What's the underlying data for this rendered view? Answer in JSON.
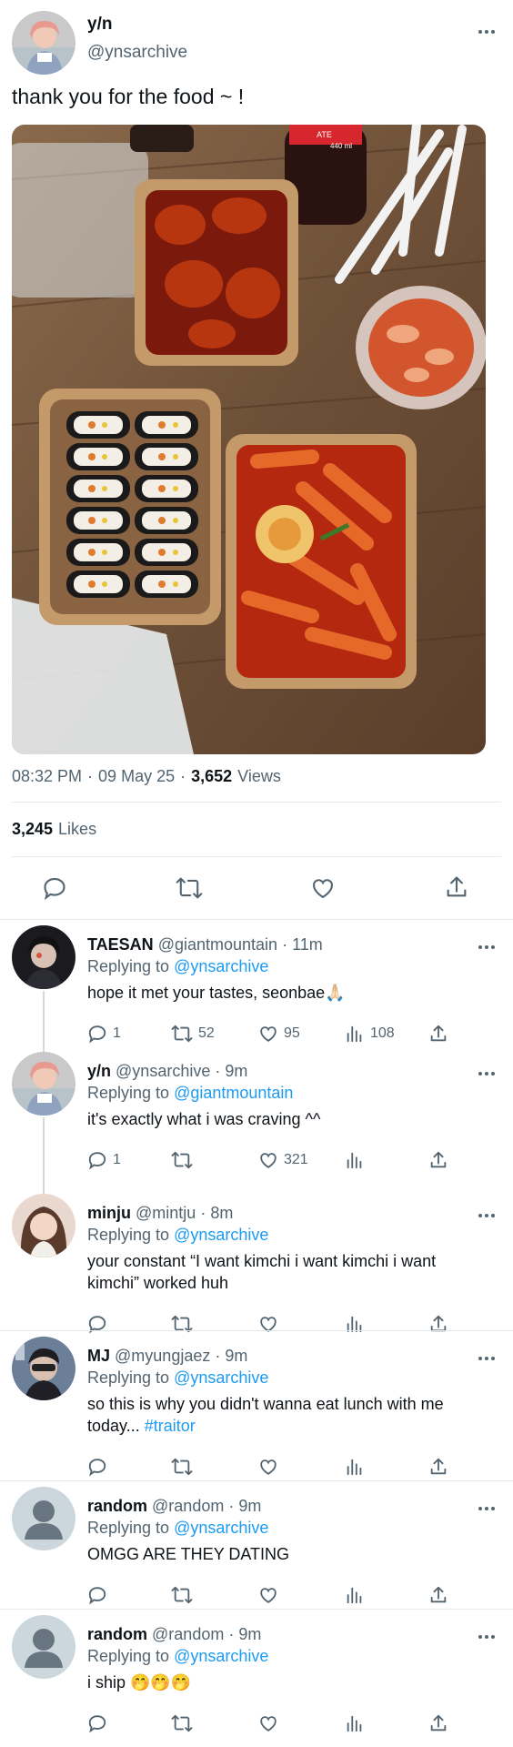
{
  "post": {
    "author_name": "y/n",
    "author_handle": "@ynsarchive",
    "text": "thank you for the food ~ !",
    "time": "08:32 PM",
    "sep1": "·",
    "date": "09 May 25",
    "sep2": "·",
    "views_count": "3,652",
    "views_label": "Views",
    "likes_count": "3,245",
    "likes_label": "Likes",
    "image_text": {
      "cola_label": "ATE",
      "cola_volume": "440 ml"
    }
  },
  "replies": [
    {
      "name": "TAESAN",
      "handle": "@giantmountain",
      "sep": "·",
      "time": "11m",
      "replying_prefix": "Replying to",
      "replying_to": "@ynsarchive",
      "text": "hope it met your tastes, seonbae🙏🏻",
      "replies": "1",
      "reposts": "52",
      "likes": "95",
      "views": "108",
      "avatar_style": "dark"
    },
    {
      "name": "y/n",
      "handle": "@ynsarchive",
      "sep": "·",
      "time": "9m",
      "replying_prefix": "Replying to",
      "replying_to": "@giantmountain",
      "text": "it's exactly what i was craving ^^",
      "replies": "1",
      "reposts": "",
      "likes": "321",
      "views": "",
      "avatar_style": "yn"
    },
    {
      "name": "minju",
      "handle": "@mintju",
      "sep": "·",
      "time": "8m",
      "replying_prefix": "Replying to",
      "replying_to": "@ynsarchive",
      "text": "your constant “I want kimchi i want kimchi i want kimchi” worked huh",
      "replies": "",
      "reposts": "",
      "likes": "",
      "views": "",
      "avatar_style": "minju"
    },
    {
      "name": "MJ",
      "handle": "@myungjaez",
      "sep": "·",
      "time": "9m",
      "replying_prefix": "Replying to",
      "replying_to": "@ynsarchive",
      "text": "so this is why you didn't wanna eat lunch with me today...",
      "hashtag": "#traitor",
      "replies": "",
      "reposts": "",
      "likes": "",
      "views": "",
      "avatar_style": "mj"
    },
    {
      "name": "random",
      "handle": "@random",
      "sep": "·",
      "time": "9m",
      "replying_prefix": "Replying to",
      "replying_to": "@ynsarchive",
      "text": "OMGG ARE THEY DATING",
      "replies": "",
      "reposts": "",
      "likes": "",
      "views": "",
      "avatar_style": "default"
    },
    {
      "name": "random",
      "handle": "@random",
      "sep": "·",
      "time": "9m",
      "replying_prefix": "Replying to",
      "replying_to": "@ynsarchive",
      "text": "i ship 🤭🤭🤭",
      "replies": "",
      "reposts": "",
      "likes": "",
      "views": "",
      "avatar_style": "default"
    }
  ],
  "colors": {
    "link": "#1d9bf0",
    "secondary_text": "#536471",
    "divider": "#e7e9ea"
  },
  "icons": [
    "more-icon",
    "reply-icon",
    "repost-icon",
    "like-icon",
    "views-icon",
    "share-icon"
  ]
}
